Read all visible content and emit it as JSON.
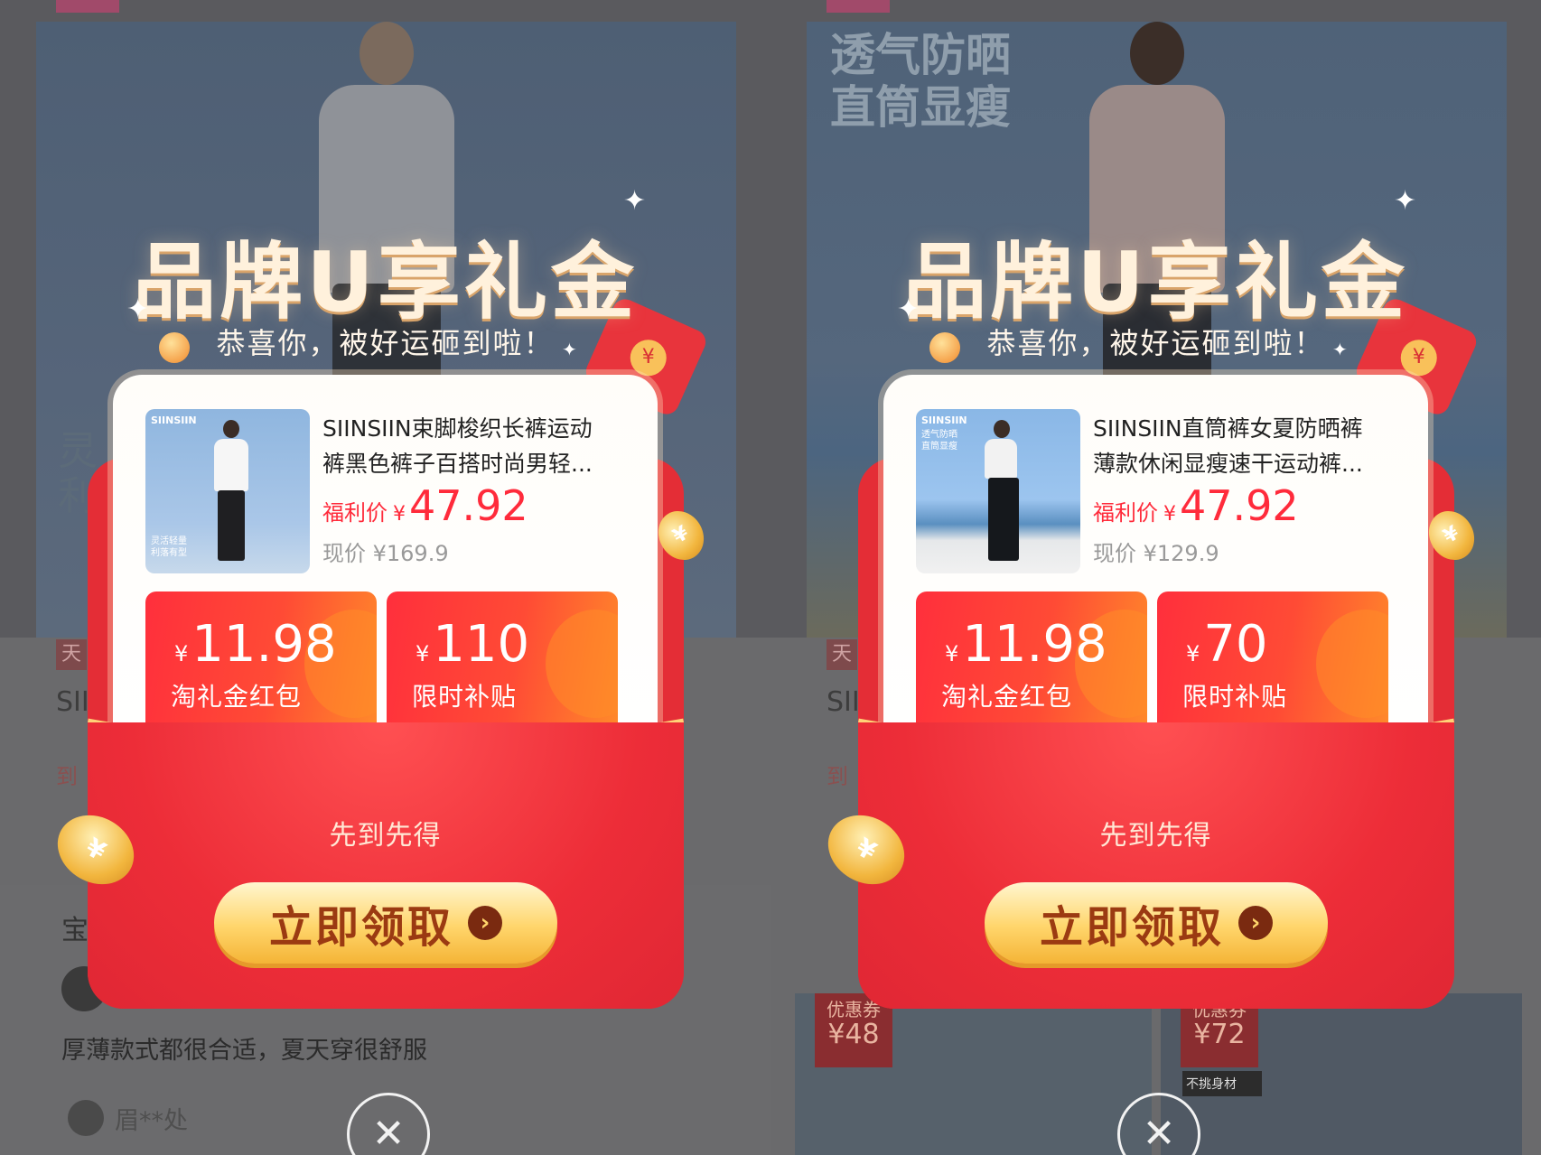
{
  "panels": [
    {
      "background": {
        "badge": "天",
        "title_fragment": "SII",
        "arrive_fragment": "到",
        "review_title": "宝",
        "review_text": "厚薄款式都很合适，夏天穿很舒服",
        "reviewer_name": "眉**处",
        "overlay_text_1": "灵",
        "overlay_text_2": "利"
      },
      "popup": {
        "title": "品牌U享礼金",
        "subtitle": "恭喜你，被好运砸到啦！",
        "product": {
          "brand": "SIINSIIN",
          "thumb_tag_1": "灵活轻量",
          "thumb_tag_2": "利落有型",
          "name_line_1": "SIINSIIN束脚梭织长裤运动",
          "name_line_2": "裤黑色裤子百搭时尚男轻...",
          "price_label": "福利价",
          "currency": "¥",
          "price": "47.92",
          "original_price": "现价 ¥169.9"
        },
        "coupons": [
          {
            "currency": "¥",
            "amount": "11.98",
            "label": "淘礼金红包"
          },
          {
            "currency": "¥",
            "amount": "110",
            "label": "限时补贴"
          }
        ],
        "first_come": "先到先得",
        "cta": "立即领取"
      }
    },
    {
      "background": {
        "badge": "天",
        "title_fragment": "SII",
        "arrive_fragment": "到",
        "banner_1": "透气防晒",
        "banner_2": "直筒显瘦",
        "grid_cards": [
          {
            "label": "优惠券",
            "amount": "¥48"
          },
          {
            "label": "优惠券",
            "amount": "¥72",
            "sub": "不挑身材"
          }
        ]
      },
      "popup": {
        "title": "品牌U享礼金",
        "subtitle": "恭喜你，被好运砸到啦！",
        "product": {
          "brand": "SIINSIIN",
          "thumb_tag_1": "透气防晒",
          "thumb_tag_2": "直筒显瘦",
          "name_line_1": "SIINSIIN直筒裤女夏防晒裤",
          "name_line_2": "薄款休闲显瘦速干运动裤...",
          "price_label": "福利价",
          "currency": "¥",
          "price": "47.92",
          "original_price": "现价 ¥129.9"
        },
        "coupons": [
          {
            "currency": "¥",
            "amount": "11.98",
            "label": "淘礼金红包"
          },
          {
            "currency": "¥",
            "amount": "70",
            "label": "限时补贴"
          }
        ],
        "first_come": "先到先得",
        "cta": "立即领取"
      }
    }
  ],
  "icons": {
    "close": "close-icon",
    "arrow": "chevron-right-icon",
    "coin": "coin-icon",
    "sparkle": "sparkle-icon"
  },
  "colors": {
    "accent_red": "#ff2b3b",
    "cta_gold": "#ffd56b",
    "envelope_red": "#e42d36"
  }
}
